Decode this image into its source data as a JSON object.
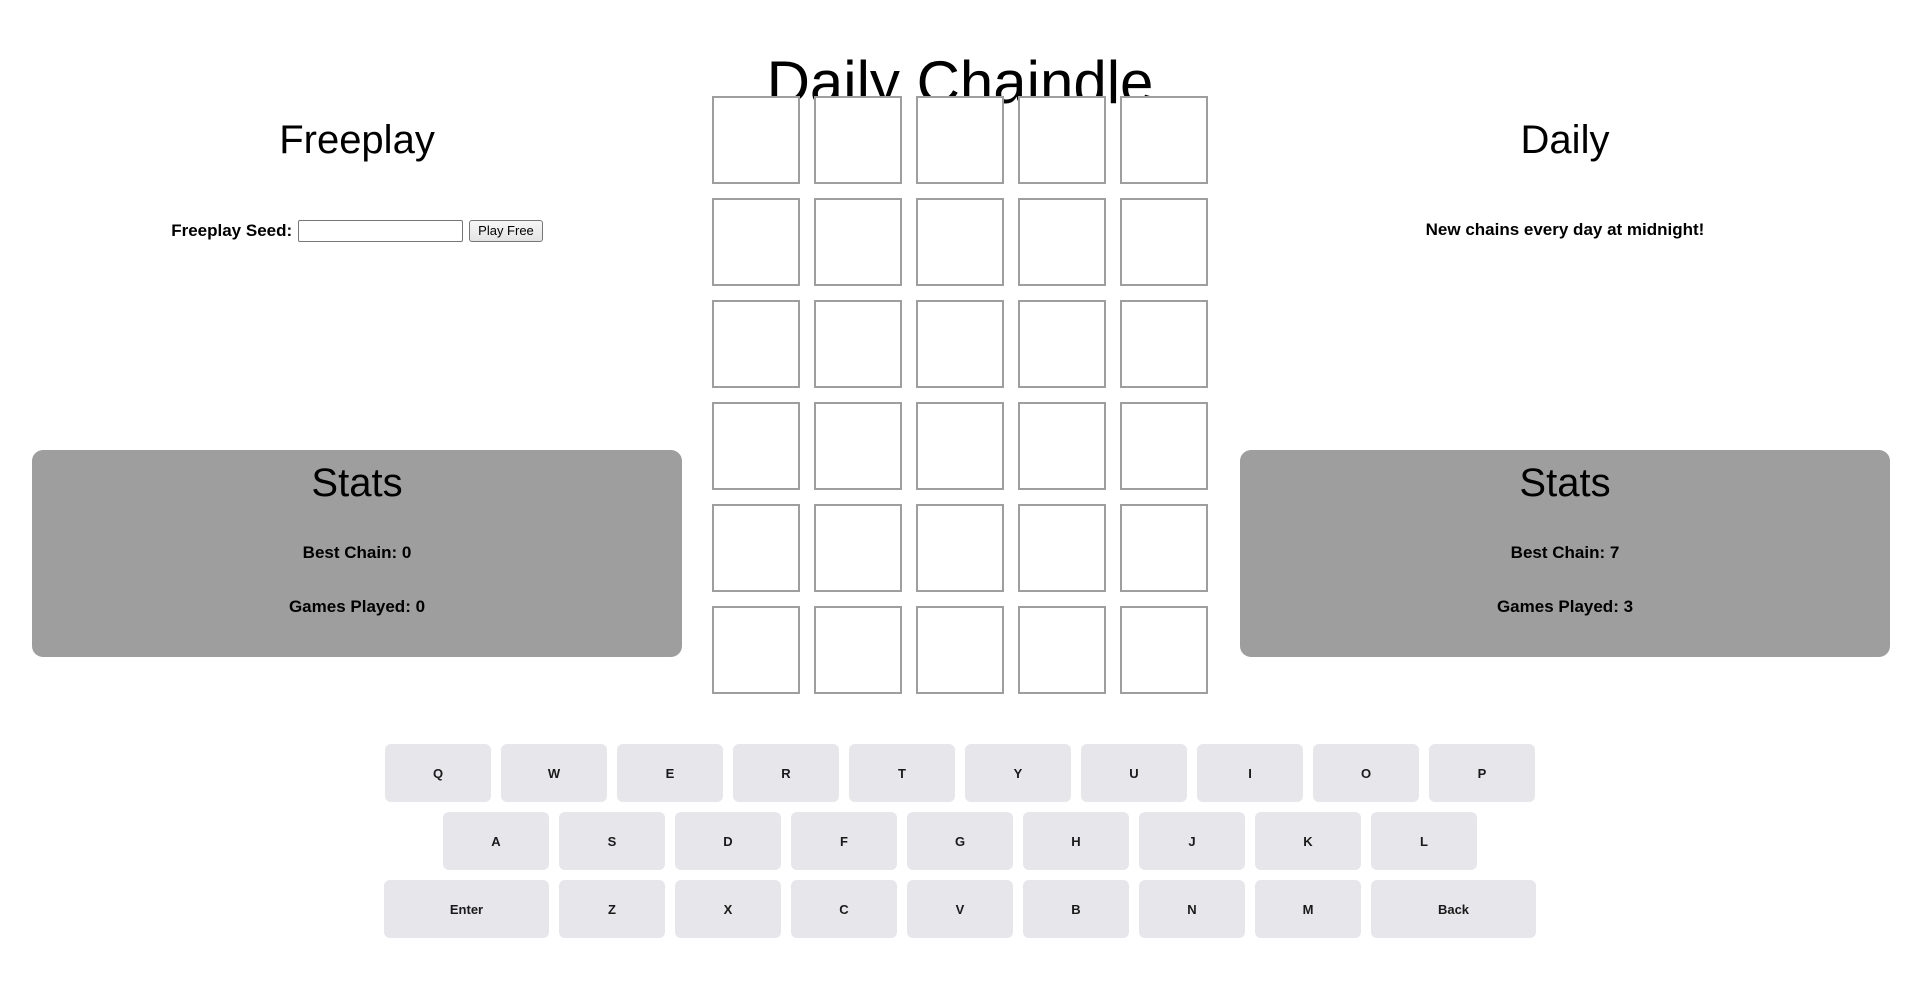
{
  "app": {
    "title": "Daily Chaindle",
    "background_color": "#ffffff"
  },
  "freeplay": {
    "heading": "Freeplay",
    "seed_label": "Freeplay Seed:",
    "seed_value": "",
    "seed_placeholder": "",
    "play_button": "Play Free",
    "stats": {
      "title": "Stats",
      "panel_color": "#9e9e9e",
      "best_chain": "Best Chain: 0",
      "games_played": "Games Played: 0"
    }
  },
  "daily": {
    "heading": "Daily",
    "note": "New chains every day at midnight!",
    "stats": {
      "title": "Stats",
      "panel_color": "#9e9e9e",
      "best_chain": "Best Chain: 7",
      "games_played": "Games Played: 3"
    }
  },
  "board": {
    "rows": 6,
    "cols": 5,
    "tile_border_color": "#9e9e9e",
    "tiles": [
      [
        "",
        "",
        "",
        "",
        ""
      ],
      [
        "",
        "",
        "",
        "",
        ""
      ],
      [
        "",
        "",
        "",
        "",
        ""
      ],
      [
        "",
        "",
        "",
        "",
        ""
      ],
      [
        "",
        "",
        "",
        "",
        ""
      ],
      [
        "",
        "",
        "",
        "",
        ""
      ]
    ]
  },
  "keyboard": {
    "key_color": "#e6e6eb",
    "rows": [
      [
        "Q",
        "W",
        "E",
        "R",
        "T",
        "Y",
        "U",
        "I",
        "O",
        "P"
      ],
      [
        "A",
        "S",
        "D",
        "F",
        "G",
        "H",
        "J",
        "K",
        "L"
      ],
      [
        "Enter",
        "Z",
        "X",
        "C",
        "V",
        "B",
        "N",
        "M",
        "Back"
      ]
    ]
  }
}
